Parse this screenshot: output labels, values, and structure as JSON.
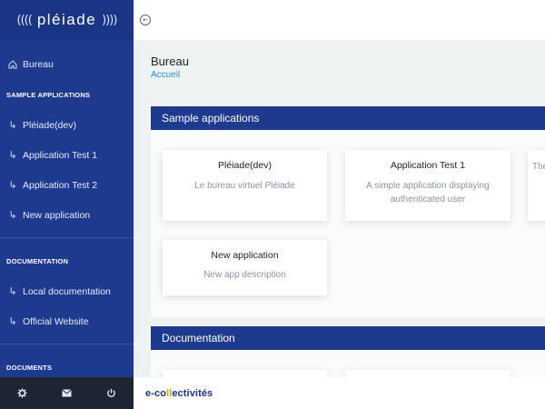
{
  "brand": {
    "waves_left": "((((",
    "name": "pléiade",
    "waves_right": "))))"
  },
  "sidebar": {
    "home": {
      "label": "Bureau",
      "icon": "home-icon"
    },
    "sections": [
      {
        "title": "SAMPLE APPLICATIONS",
        "items": [
          "Pléiade(dev)",
          "Application Test 1",
          "Application Test 2",
          "New application"
        ]
      },
      {
        "title": "DOCUMENTATION",
        "items": [
          "Local documentation",
          "Official Website"
        ]
      },
      {
        "title": "DOCUMENTS",
        "items": []
      }
    ],
    "footer": [
      "gear-icon",
      "mail-icon",
      "power-icon"
    ]
  },
  "topbar": {
    "back_icon": "arrow-left-circle-icon"
  },
  "page": {
    "title": "Bureau",
    "breadcrumb": "Accueil"
  },
  "panels": [
    {
      "title": "Sample applications",
      "cards": [
        {
          "title": "Pléiade(dev)",
          "desc": "Le bureau virtuel Pléiade"
        },
        {
          "title": "Application Test 1",
          "desc": "A simple application displaying authenticated user"
        },
        {
          "title": "",
          "desc": "The"
        },
        {
          "title": "New application",
          "desc": "New app description"
        }
      ]
    },
    {
      "title": "Documentation"
    }
  ],
  "bottombar": {
    "logo_prefix": "e-co",
    "logo_l": "ll",
    "logo_suffix": "ectivités"
  },
  "colors": {
    "sidebar": "#1d3a8f",
    "accent_link": "#2b8ed8",
    "footer": "#1f2433"
  }
}
